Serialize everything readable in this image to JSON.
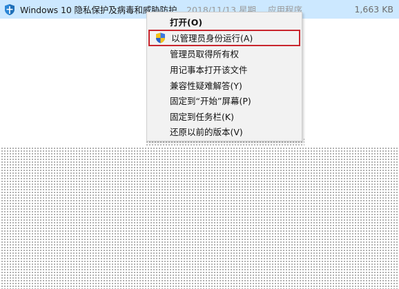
{
  "file_row": {
    "icon": "windows-defender-shield-icon",
    "name": "Windows 10 隐私保护及病毒和威胁防护",
    "date": "2018/11/13 星期...",
    "type": "应用程序",
    "size": "1,663 KB"
  },
  "context_menu": {
    "items": [
      {
        "label": "打开(O)",
        "bold": true
      },
      {
        "label": "以管理员身份运行(A)",
        "icon": "uac-shield-icon",
        "highlighted": true
      },
      {
        "label": "管理员取得所有权"
      },
      {
        "label": "用记事本打开该文件"
      },
      {
        "label": "兼容性疑难解答(Y)"
      },
      {
        "label": "固定到“开始”屏幕(P)"
      },
      {
        "label": "固定到任务栏(K)"
      },
      {
        "label": "还原以前的版本(V)"
      }
    ]
  },
  "colors": {
    "selection": "#cce8ff",
    "menu_bg": "#f2f2f2",
    "highlight_border": "#c9252d"
  }
}
